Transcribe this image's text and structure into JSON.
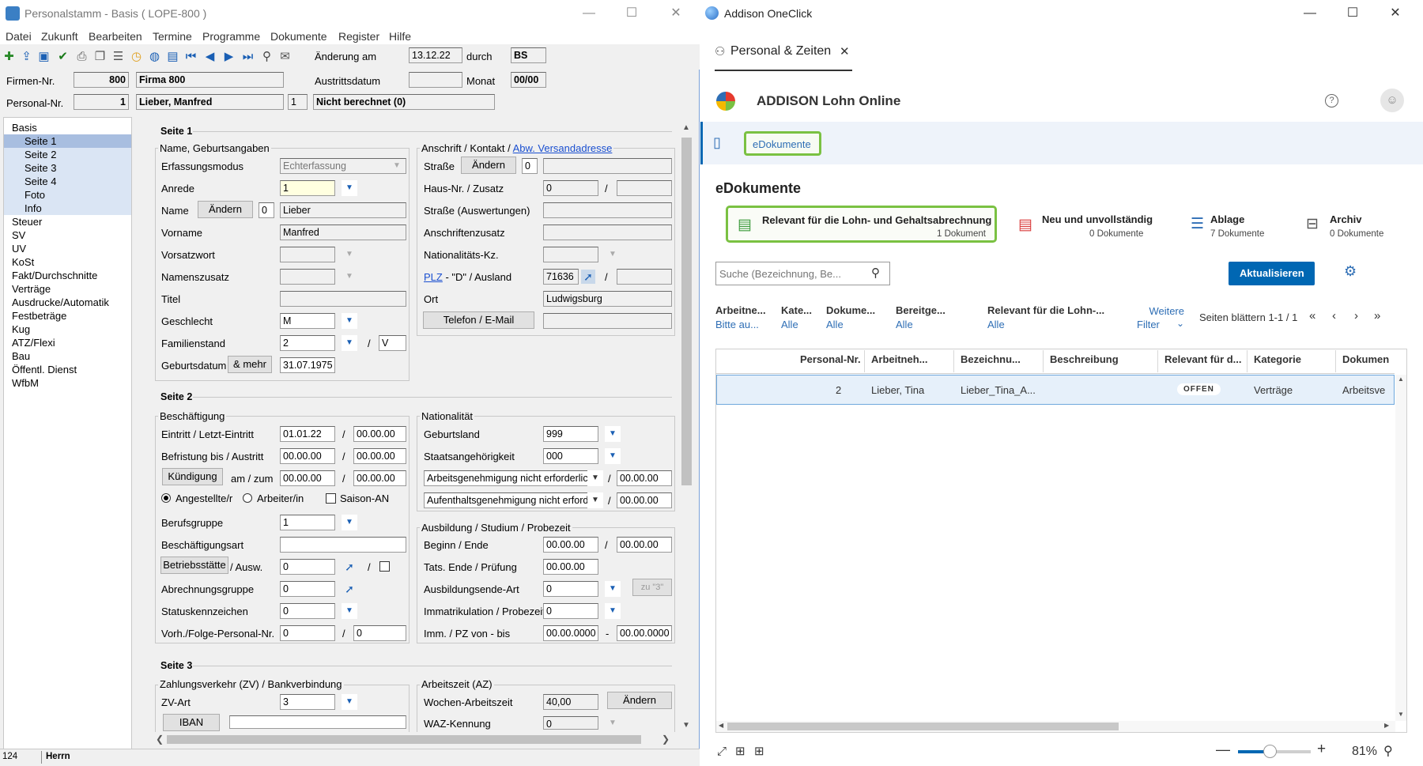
{
  "left_window": {
    "title": "Personalstamm - Basis  ( LOPE-800 )",
    "menu": [
      "Datei",
      "Zukunft",
      "Bearbeiten",
      "Termine",
      "Programme",
      "Dokumente",
      "Register",
      "Hilfe"
    ],
    "header": {
      "aenderung_label": "Änderung am",
      "aenderung_value": "13.12.22",
      "durch_label": "durch",
      "durch_value": "BS",
      "firmen_label": "Firmen-Nr.",
      "firmen_nr": "800",
      "firmen_name": "Firma 800",
      "austritt_label": "Austrittsdatum",
      "monat_label": "Monat",
      "monat_value": "00/00",
      "personal_label": "Personal-Nr.",
      "personal_nr": "1",
      "personal_name": "Lieber, Manfred",
      "personal_sub": "1",
      "berechnet": "Nicht berechnet (0)"
    },
    "nav": [
      {
        "label": "Basis",
        "level": 0
      },
      {
        "label": "Seite 1",
        "level": 1,
        "selected": true
      },
      {
        "label": "Seite 2",
        "level": 1
      },
      {
        "label": "Seite 3",
        "level": 1
      },
      {
        "label": "Seite 4",
        "level": 1
      },
      {
        "label": "Foto",
        "level": 1
      },
      {
        "label": "Info",
        "level": 1
      },
      {
        "label": "Steuer",
        "level": 0
      },
      {
        "label": "SV",
        "level": 0
      },
      {
        "label": "UV",
        "level": 0
      },
      {
        "label": "KoSt",
        "level": 0
      },
      {
        "label": "Fakt/Durchschnitte",
        "level": 0
      },
      {
        "label": "Verträge",
        "level": 0
      },
      {
        "label": "Ausdrucke/Automatik",
        "level": 0
      },
      {
        "label": "Festbeträge",
        "level": 0
      },
      {
        "label": "Kug",
        "level": 0
      },
      {
        "label": "ATZ/Flexi",
        "level": 0
      },
      {
        "label": "Bau",
        "level": 0
      },
      {
        "label": "Öffentl. Dienst",
        "level": 0
      },
      {
        "label": "WfbM",
        "level": 0
      }
    ],
    "seite1": {
      "title": "Seite 1",
      "name_group": "Name, Geburtsangaben",
      "erfassungsmodus_label": "Erfassungsmodus",
      "erfassungsmodus": "Echterfassung",
      "anrede_label": "Anrede",
      "anrede": "1",
      "name_label": "Name",
      "aendern": "Ändern",
      "name_idx": "0",
      "name": "Lieber",
      "vorname_label": "Vorname",
      "vorname": "Manfred",
      "vorsatzwort_label": "Vorsatzwort",
      "namenszusatz_label": "Namenszusatz",
      "titel_label": "Titel",
      "geschlecht_label": "Geschlecht",
      "geschlecht": "M",
      "familienstand_label": "Familienstand",
      "familienstand": "2",
      "familienstand2": "V",
      "geburtsdatum_label": "Geburtsdatum",
      "mehr": "& mehr",
      "geburtsdatum": "31.07.1975",
      "anschrift_group": "Anschrift / Kontakt / ",
      "abw_link": "Abw. Versandadresse",
      "strasse_label": "Straße",
      "strasse_idx": "0",
      "hausnr_label": "Haus-Nr. / Zusatz",
      "hausnr": "0",
      "strasse_ausw_label": "Straße (Auswertungen)",
      "anschriftenzusatz_label": "Anschriftenzusatz",
      "nationalitaet_label": "Nationalitäts-Kz.",
      "plz_link": "PLZ",
      "plz_label_rest": " - \"D\" / Ausland",
      "plz": "71636",
      "ort_label": "Ort",
      "ort": "Ludwigsburg",
      "telefon_btn": "Telefon / E-Mail",
      "slash": "/"
    },
    "seite2": {
      "title": "Seite 2",
      "beschaeftigung_group": "Beschäftigung",
      "eintritt_label": "Eintritt / Letzt-Eintritt",
      "eintritt": "01.01.22",
      "letzt_eintritt": "00.00.00",
      "befristung_label": "Befristung bis / Austritt",
      "befristung": "00.00.00",
      "austritt": "00.00.00",
      "kuendigung_btn": "Kündigung",
      "amzum_label": "am / zum",
      "kuendigung_am": "00.00.00",
      "kuendigung_zum": "00.00.00",
      "angestellte": "Angestellte/r",
      "arbeiter": "Arbeiter/in",
      "saison": "Saison-AN",
      "berufsgruppe_label": "Berufsgruppe",
      "berufsgruppe": "1",
      "beschaeftigungsart_label": "Beschäftigungsart",
      "betriebsstaette_btn": "Betriebsstätte",
      "ausw_label": "/ Ausw.",
      "betriebsstaette": "0",
      "abrechnungsgruppe_label": "Abrechnungsgruppe",
      "abrechnungsgruppe": "0",
      "statuskennzeichen_label": "Statuskennzeichen",
      "statuskennzeichen": "0",
      "vorh_label": "Vorh./Folge-Personal-Nr.",
      "vorh": "0",
      "folge": "0",
      "nationalitaet_group": "Nationalität",
      "geburtsland_label": "Geburtsland",
      "geburtsland": "999",
      "staatsang_label": "Staatsangehörigkeit",
      "staatsang": "000",
      "arbeitsgen": "Arbeitsgenehmigung nicht erforderlic",
      "arbeitsgen_date": "00.00.00",
      "aufenthaltsgen": "Aufenthaltsgenehmigung nicht erford",
      "aufenthaltsgen_date": "00.00.00",
      "ausbildung_group": "Ausbildung / Studium / Probezeit",
      "beginn_label": "Beginn / Ende",
      "beginn": "00.00.00",
      "ende": "00.00.00",
      "tats_label": "Tats. Ende / Prüfung",
      "tats": "00.00.00",
      "ausbildungsende_label": "Ausbildungsende-Art",
      "ausbildungsende": "0",
      "zu3_btn": "zu \"3\"",
      "immatrikulation_label": "Immatrikulation / Probezeit",
      "immatrikulation": "0",
      "imm_label": "Imm. / PZ von - bis",
      "imm_von": "00.00.0000",
      "imm_bis": "00.00.0000",
      "dash": "-"
    },
    "seite3": {
      "title": "Seite 3",
      "zahlung_group": "Zahlungsverkehr (ZV) / Bankverbindung",
      "zvart_label": "ZV-Art",
      "zvart": "3",
      "iban_btn": "IBAN",
      "arbeitszeit_group": "Arbeitszeit (AZ)",
      "wochen_label": "Wochen-Arbeitszeit",
      "wochen": "40,00",
      "aendern_btn": "Ändern",
      "waz_label": "WAZ-Kennung",
      "waz": "0"
    },
    "status": {
      "left": "124",
      "right": "Herrn"
    }
  },
  "right_window": {
    "title": "Addison OneClick",
    "tab": "Personal & Zeiten",
    "app_title": "ADDISON Lohn Online",
    "breadcrumb": "eDokumente",
    "section_title": "eDokumente",
    "cards": [
      {
        "title": "Relevant für die Lohn- und Gehaltsabrechnung",
        "sub": "1 Dokument",
        "icon": "payroll-doc-icon",
        "active": true
      },
      {
        "title": "Neu und unvollständig",
        "sub": "0 Dokumente",
        "icon": "new-doc-icon"
      },
      {
        "title": "Ablage",
        "sub": "7 Dokumente",
        "icon": "list-icon"
      },
      {
        "title": "Archiv",
        "sub": "0 Dokumente",
        "icon": "archive-icon"
      }
    ],
    "search_placeholder": "Suche (Bezeichnung, Be...",
    "refresh_btn": "Aktualisieren",
    "filters": [
      {
        "label": "Arbeitne...",
        "value": "Bitte au..."
      },
      {
        "label": "Kate...",
        "value": "Alle"
      },
      {
        "label": "Dokume...",
        "value": "Alle"
      },
      {
        "label": "Bereitge...",
        "value": "Alle"
      },
      {
        "label": "Relevant für die Lohn-...",
        "value": "Alle"
      }
    ],
    "more_filters_1": "Weitere",
    "more_filters_2": "Filter",
    "pager": "Seiten blättern 1-1 / 1",
    "columns": [
      "Personal-Nr.",
      "Arbeitneh...",
      "Bezeichnu...",
      "Beschreibung",
      "Relevant für d...",
      "Kategorie",
      "Dokumen"
    ],
    "rows": [
      {
        "nr": "2",
        "arbeitnehmer": "Lieber, Tina",
        "bezeichnung": "Lieber_Tina_A...",
        "beschreibung": "",
        "relevant": "OFFEN",
        "kategorie": "Verträge",
        "dokument": "Arbeitsve"
      }
    ],
    "zoom": "81%",
    "colors": {
      "accent": "#0067b3",
      "highlight": "#7ac142"
    }
  }
}
